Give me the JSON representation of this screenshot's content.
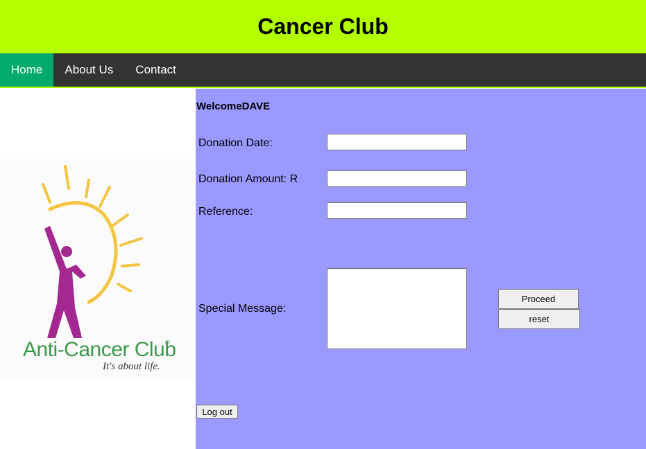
{
  "header": {
    "title": "Cancer Club"
  },
  "nav": {
    "items": [
      {
        "label": "Home",
        "active": true
      },
      {
        "label": "About Us"
      },
      {
        "label": "Contact"
      }
    ]
  },
  "logo": {
    "brand": "Anti-Cancer Club",
    "registered": "®",
    "tagline": "It's about life."
  },
  "main": {
    "welcome": "WelcomeDAVE",
    "form": {
      "donation_date_label": "Donation Date:",
      "donation_date_value": "",
      "donation_amount_label": "Donation Amount: R",
      "donation_amount_value": "",
      "reference_label": "Reference:",
      "reference_value": "",
      "special_message_label": "Special Message:",
      "special_message_value": "",
      "proceed_label": "Proceed",
      "reset_label": "reset"
    },
    "logout_label": "Log out"
  },
  "colors": {
    "header_bg": "#b3ff00",
    "nav_bg": "#333333",
    "nav_active": "#04aa6d",
    "main_bg": "#9999ff",
    "logo_purple": "#a3288f",
    "logo_sun": "#f4c542",
    "logo_green": "#3a9a48"
  }
}
